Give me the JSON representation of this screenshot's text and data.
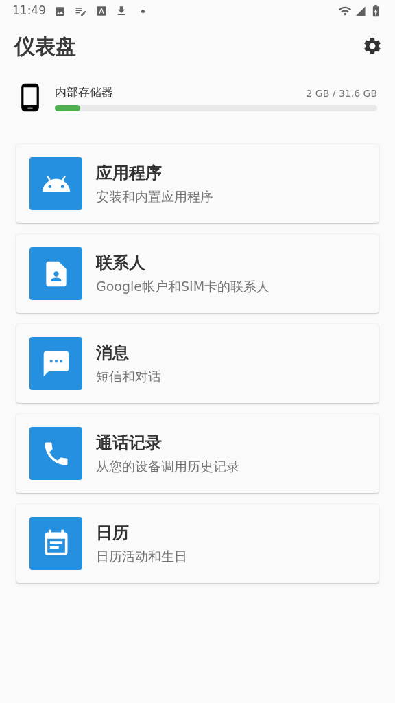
{
  "status_bar": {
    "time": "11:49"
  },
  "header": {
    "title": "仪表盘"
  },
  "storage": {
    "label": "内部存储器",
    "reading": "2 GB / 31.6 GB",
    "level": 0.078
  },
  "cards": [
    {
      "kind": "apps",
      "title": "应用程序",
      "subtitle": "安装和内置应用程序"
    },
    {
      "kind": "contacts",
      "title": "联系人",
      "subtitle": "Google帐户和SIM卡的联系人"
    },
    {
      "kind": "messages",
      "title": "消息",
      "subtitle": "短信和对话"
    },
    {
      "kind": "calls",
      "title": "通话记录",
      "subtitle": "从您的设备调用历史记录"
    },
    {
      "kind": "calendar",
      "title": "日历",
      "subtitle": "日历活动和生日"
    }
  ]
}
